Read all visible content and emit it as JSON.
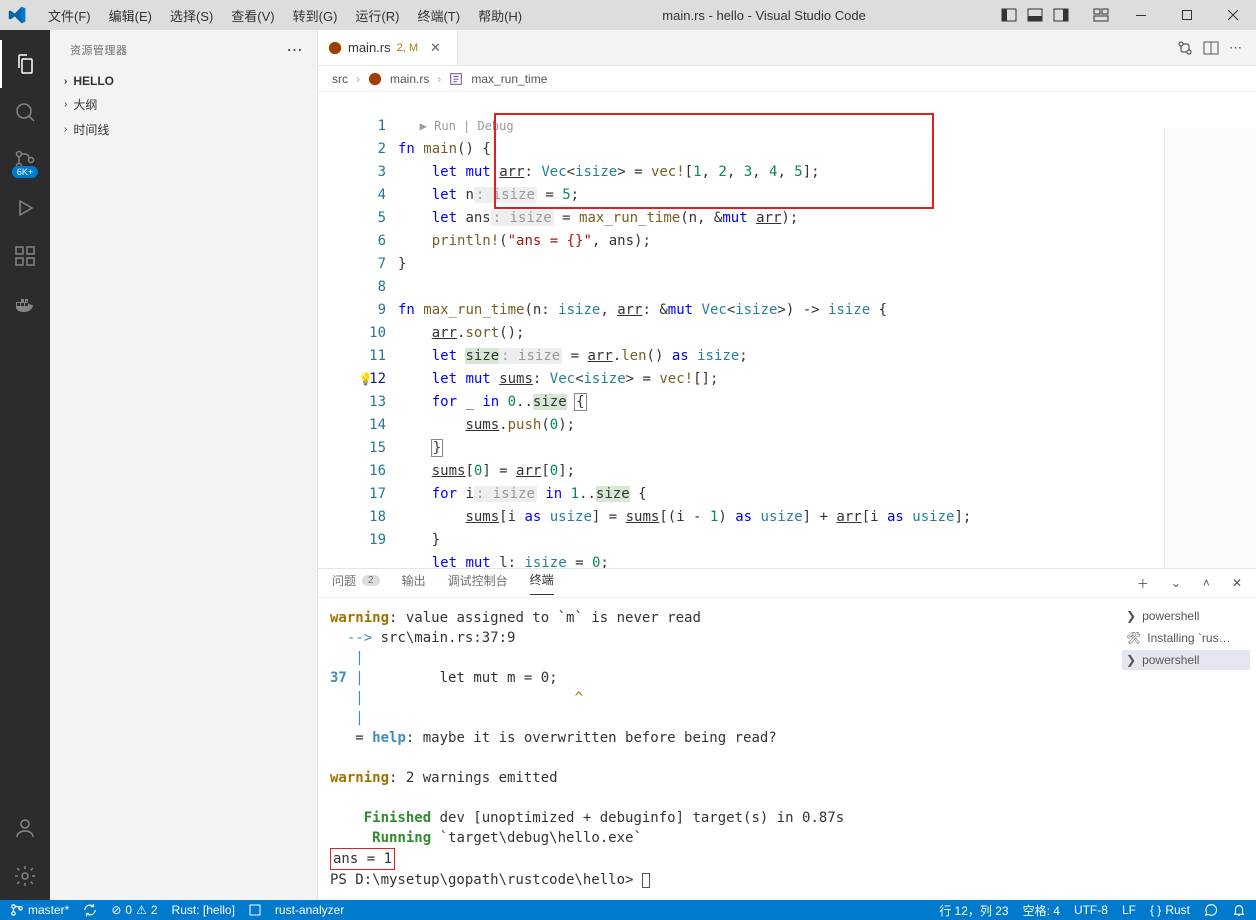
{
  "titlebar": {
    "menus": [
      "文件(F)",
      "编辑(E)",
      "选择(S)",
      "查看(V)",
      "转到(G)",
      "运行(R)",
      "终端(T)",
      "帮助(H)"
    ],
    "title": "main.rs - hello - Visual Studio Code"
  },
  "activitybar": {
    "badge": "6K+"
  },
  "sidebar": {
    "title": "资源管理器",
    "sections": [
      "HELLO",
      "大纲",
      "时间线"
    ]
  },
  "tab": {
    "icon": "rust",
    "name": "main.rs",
    "meta": "2, M"
  },
  "breadcrumb": {
    "parts": [
      "src",
      "main.rs",
      "max_run_time"
    ]
  },
  "codelens": "Run | Debug",
  "code": {
    "lines": [
      "fn main() {",
      "    let mut arr: Vec<isize> = vec![1, 2, 3, 4, 5];",
      "    let n: isize = 5;",
      "    let ans: isize = max_run_time(n, &mut arr);",
      "    println!(\"ans = {}\", ans);",
      "}",
      "",
      "fn max_run_time(n: isize, arr: &mut Vec<isize>) -> isize {",
      "    arr.sort();",
      "    let size: isize = arr.len() as isize;",
      "    let mut sums: Vec<isize> = vec![];",
      "    for _ in 0..size {",
      "        sums.push(0);",
      "    }",
      "    sums[0] = arr[0];",
      "    for i: isize in 1..size {",
      "        sums[i as usize] = sums[(i - 1) as usize] + arr[i as usize];",
      "    }",
      "    let mut l: isize = 0;"
    ],
    "current_line": 12
  },
  "panel": {
    "tabs": [
      "问题",
      "输出",
      "调试控制台",
      "终端"
    ],
    "problems_count": "2",
    "active": "终端"
  },
  "terminal": {
    "warning1_head": "warning",
    "warning1_msg": ": value assigned to `m` is never read",
    "arrow_loc": "src\\main.rs:37:9",
    "ln37": "37",
    "code37": "        let mut m = 0;",
    "carets": "                ^",
    "help_lbl": "help",
    "help_msg": ": maybe it is overwritten before being read?",
    "warning2_head": "warning",
    "warning2_msg": ": 2 warnings emitted",
    "finished_lbl": "Finished",
    "finished_msg": " dev [unoptimized + debuginfo] target(s) in 0.87s",
    "running_lbl": "Running",
    "running_msg": " `target\\debug\\hello.exe`",
    "ans": "ans = 1",
    "prompt": "PS D:\\mysetup\\gopath\\rustcode\\hello> "
  },
  "term_side": {
    "items": [
      "powershell",
      "Installing `rus…",
      "powershell"
    ],
    "active_index": 2
  },
  "statusbar": {
    "branch": "master*",
    "errors": "0",
    "warnings": "2",
    "rust_proj": "Rust: [hello]",
    "analyzer": "rust-analyzer",
    "pos": "行 12，列 23",
    "spaces": "空格: 4",
    "enc": "UTF-8",
    "eol": "LF",
    "lang": "Rust"
  }
}
